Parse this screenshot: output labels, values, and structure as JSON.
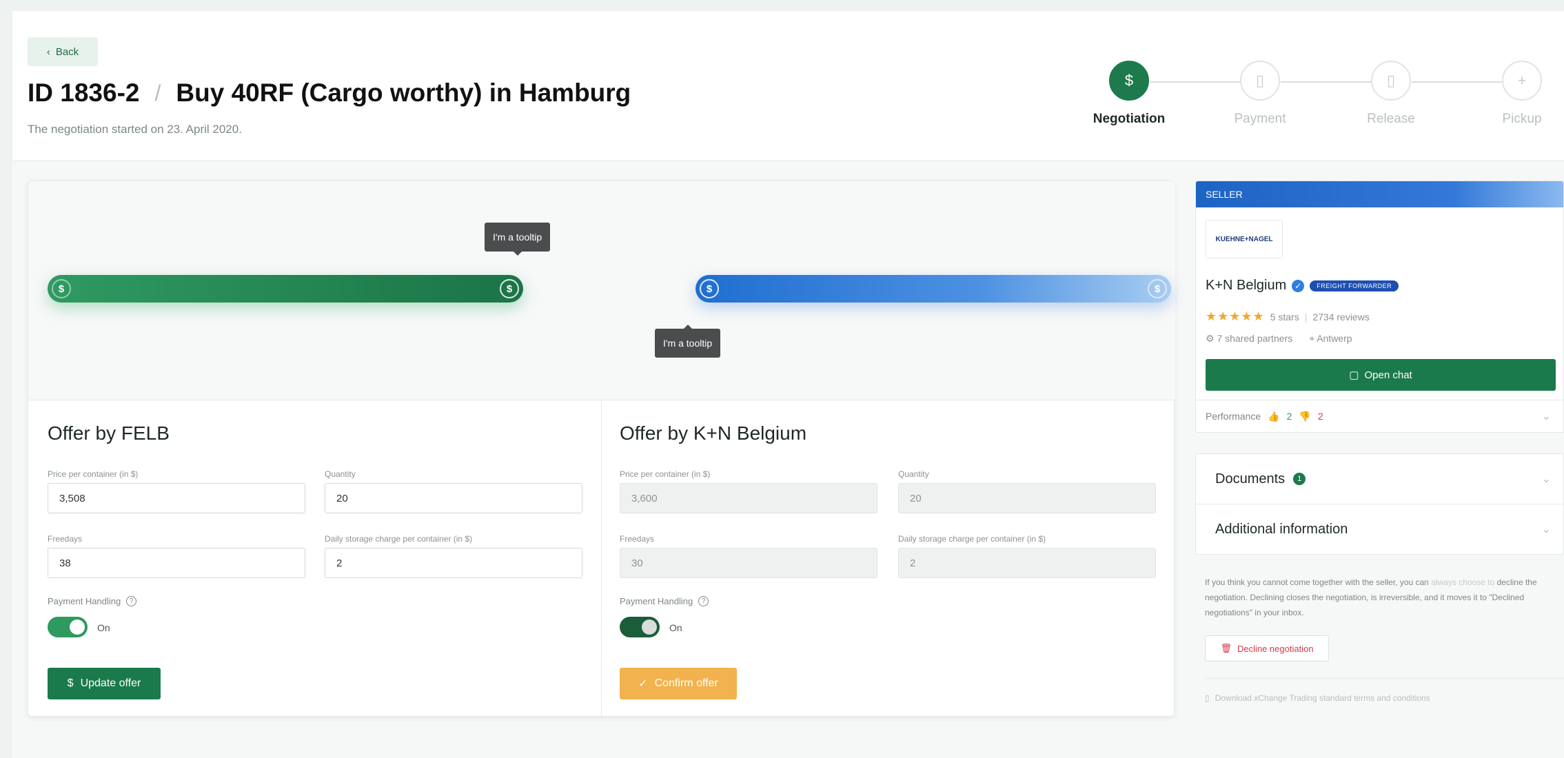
{
  "header": {
    "back_label": "Back",
    "id": "ID 1836-2",
    "separator": "/",
    "title": "Buy 40RF (Cargo worthy) in Hamburg",
    "subtitle": "The negotiation started on 23. April 2020."
  },
  "steps": [
    {
      "label": "Negotiation",
      "icon": "dollar-chat-icon",
      "active": true
    },
    {
      "label": "Payment",
      "icon": "document-icon",
      "active": false
    },
    {
      "label": "Release",
      "icon": "release-document-icon",
      "active": false
    },
    {
      "label": "Pickup",
      "icon": "pickup-icon",
      "active": false
    }
  ],
  "slider": {
    "tooltip_top": "I'm a tooltip",
    "tooltip_bottom": "I'm a tooltip",
    "colors": {
      "buyer": "#1b7a4b",
      "seller": "#1f6ed0"
    }
  },
  "offer_buyer": {
    "title": "Offer by FELB",
    "price_label": "Price per container (in $)",
    "price_value": "3,508",
    "quantity_label": "Quantity",
    "quantity_value": "20",
    "freedays_label": "Freedays",
    "freedays_value": "38",
    "storage_label": "Daily storage charge per container (in $)",
    "storage_value": "2",
    "payment_label": "Payment Handling",
    "toggle_text": "On",
    "button_label": "Update offer"
  },
  "offer_seller": {
    "title": "Offer by K+N Belgium",
    "price_label": "Price per container (in $)",
    "price_value": "3,600",
    "quantity_label": "Quantity",
    "quantity_value": "20",
    "freedays_label": "Freedays",
    "freedays_value": "30",
    "storage_label": "Daily storage charge per container (in $)",
    "storage_value": "2",
    "payment_label": "Payment Handling",
    "toggle_text": "On",
    "button_label": "Confirm offer"
  },
  "seller": {
    "header": "SELLER",
    "logo_text": "KUEHNE+NAGEL",
    "name": "K+N Belgium",
    "badge": "FREIGHT FORWARDER",
    "stars": "★★★★★",
    "stars_text": "5 stars",
    "reviews": "2734 reviews",
    "partners": "7 shared partners",
    "location": "Antwerp",
    "chat_label": "Open chat",
    "performance_label": "Performance",
    "thumbs_up_count": "2",
    "thumbs_down_count": "2"
  },
  "accordions": {
    "documents": "Documents",
    "documents_count": "1",
    "additional": "Additional information"
  },
  "decline": {
    "text_1": "If you think you cannot come together with the seller, you can",
    "text_link": "always choose to",
    "text_2": "decline the negotiation. Declining closes the negotiation, is irreversible, and it moves it to \"Declined negotiations\" in your inbox.",
    "button_label": "Decline negotiation",
    "download_label": "Download xChange Trading standard terms and conditions"
  }
}
